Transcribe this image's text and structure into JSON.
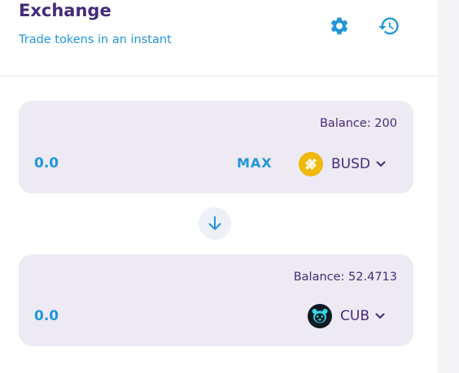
{
  "header": {
    "title": "Exchange",
    "subtitle": "Trade tokens in an instant",
    "settings_icon": "gear-icon",
    "history_icon": "history-icon"
  },
  "from": {
    "balance": "Balance: 200",
    "amount_value": "0.0",
    "max_label": "MAX",
    "token": "BUSD",
    "token_icon": "busd-logo-icon"
  },
  "swap": {
    "icon": "arrow-down-icon"
  },
  "to": {
    "balance": "Balance: 52.4713",
    "amount_value": "0.0",
    "token": "CUB",
    "token_icon": "cub-logo-icon"
  },
  "colors": {
    "title": "#452a7a",
    "accent": "#2196d9",
    "panel_bg": "#eeeaf4",
    "busd": "#f0b90b"
  }
}
